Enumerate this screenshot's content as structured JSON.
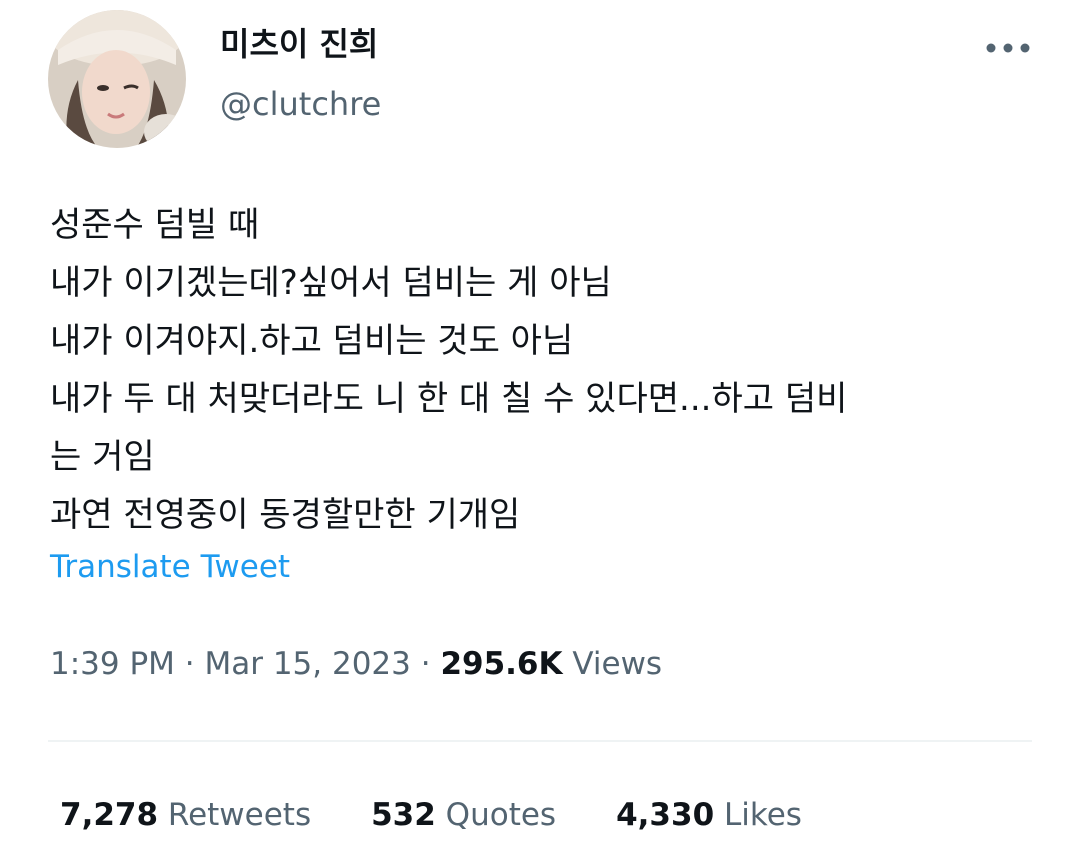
{
  "author": {
    "display_name": "미츠이 진희",
    "handle": "@clutchre"
  },
  "tweet": {
    "lines": [
      "성준수 덤빌 때",
      "내가 이기겠는데?싶어서 덤비는 게 아님",
      "내가 이겨야지.하고 덤비는 것도 아님",
      "내가 두 대 처맞더라도 니 한 대 칠 수 있다면...하고 덤비",
      "는 거임",
      "과연 전영중이 동경할만한 기개임"
    ],
    "translate_label": "Translate Tweet"
  },
  "meta": {
    "time": "1:39 PM",
    "sep1": " · ",
    "date": "Mar 15, 2023",
    "sep2": " · ",
    "views_count": "295.6K",
    "views_label": " Views"
  },
  "stats": {
    "retweets_count": "7,278",
    "retweets_label": " Retweets",
    "quotes_count": "532",
    "quotes_label": " Quotes",
    "likes_count": "4,330",
    "likes_label": " Likes"
  },
  "colors": {
    "link": "#1d9bf0",
    "secondary_text": "#536471",
    "primary_text": "#0f1419",
    "divider": "#eff3f4"
  },
  "icons": {
    "more": "more-horizontal-icon"
  }
}
